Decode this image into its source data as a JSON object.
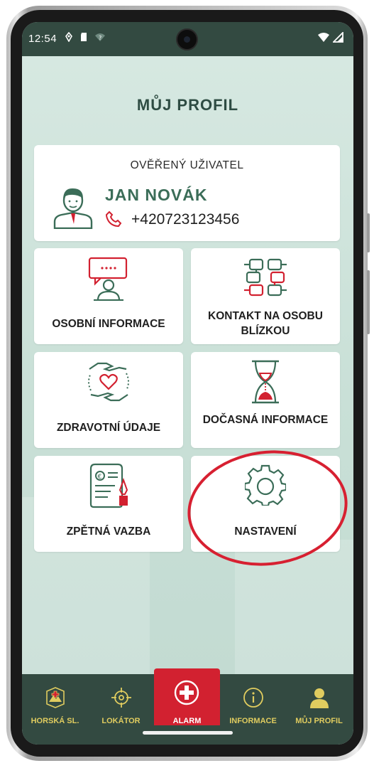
{
  "status_bar": {
    "time": "12:54"
  },
  "page": {
    "title": "MŮJ PROFIL"
  },
  "profile": {
    "verified_label": "OVĚŘENÝ UŽIVATEL",
    "name": "JAN NOVÁK",
    "phone": "+420723123456"
  },
  "tiles": [
    {
      "label": "OSOBNÍ INFORMACE",
      "icon": "person-speech-icon"
    },
    {
      "label": "KONTAKT NA OSOBU BLÍZKOU",
      "icon": "linked-hands-icon"
    },
    {
      "label": "ZDRAVOTNÍ ÚDAJE",
      "icon": "hands-heart-icon"
    },
    {
      "label": "DOČASNÁ INFORMACE",
      "icon": "hourglass-icon"
    },
    {
      "label": "ZPĚTNÁ VAZBA",
      "icon": "document-quill-icon"
    },
    {
      "label": "NASTAVENÍ",
      "icon": "gear-icon"
    }
  ],
  "bottom_nav": [
    {
      "label": "HORSKÁ SL.",
      "icon": "mountain-rescue-badge-icon"
    },
    {
      "label": "LOKÁTOR",
      "icon": "crosshair-icon"
    },
    {
      "label": "ALARM",
      "icon": "medical-cross-icon",
      "active": true
    },
    {
      "label": "INFORMACE",
      "icon": "info-icon"
    },
    {
      "label": "MŮJ PROFIL",
      "icon": "user-icon"
    }
  ],
  "colors": {
    "primary_dark": "#334a41",
    "accent_red": "#d22130",
    "nav_label": "#e0cc5f",
    "icon_green": "#3b6d58",
    "background": "#cde4dc"
  }
}
